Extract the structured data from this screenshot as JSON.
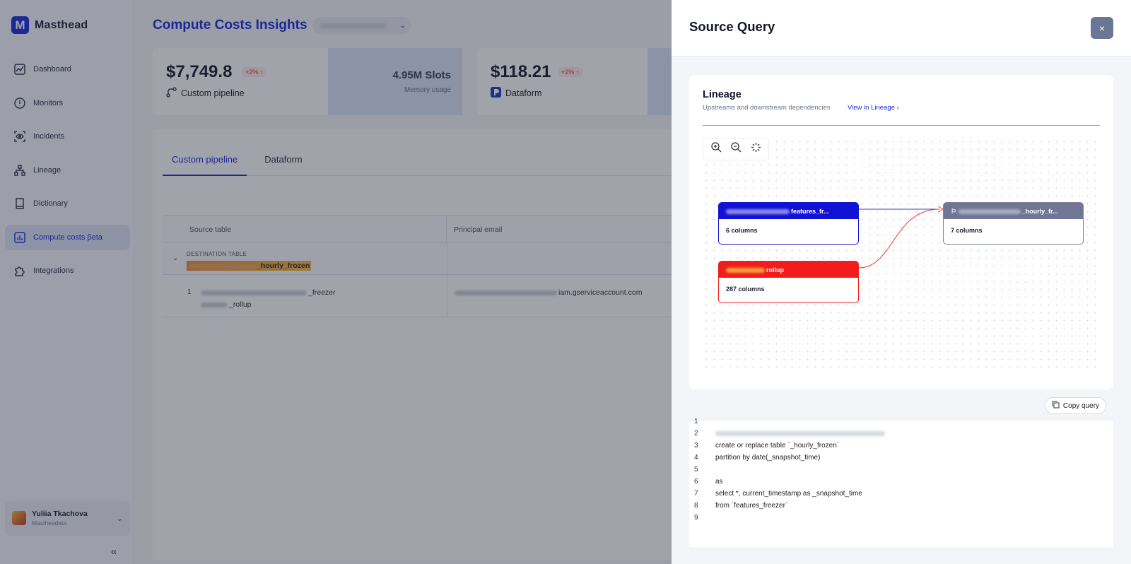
{
  "brand": {
    "logo_letter": "M",
    "name": "Masthead"
  },
  "sidebar": {
    "items": [
      {
        "label": "Dashboard",
        "icon": "chart-line-icon"
      },
      {
        "label": "Monitors",
        "icon": "alert-circle-icon"
      },
      {
        "label": "Incidents",
        "icon": "eye-icon"
      },
      {
        "label": "Lineage",
        "icon": "lineage-icon"
      },
      {
        "label": "Dictionary",
        "icon": "book-icon"
      },
      {
        "label": "Compute costs βeta",
        "icon": "bar-chart-icon",
        "active": true
      },
      {
        "label": "Integrations",
        "icon": "puzzle-icon"
      }
    ],
    "user": {
      "name": "Yuliia Tkachova",
      "org": "Mastheadata"
    },
    "collapse_label": "«"
  },
  "main": {
    "title": "Compute Costs Insights",
    "metrics": [
      {
        "value": "$7,749.8",
        "badge": "+2% ↑",
        "label": "Custom pipeline",
        "side_value": "4.95M Slots",
        "side_label": "Memory usage"
      },
      {
        "value": "$118.21",
        "badge": "+2% ↑",
        "label": "Dataform"
      }
    ],
    "tabs": [
      "Custom pipeline",
      "Dataform"
    ],
    "table": {
      "headers": [
        "Source table",
        "Principal email"
      ],
      "group_caption": "DESTINATION TABLE",
      "group_value": "_hourly_frozen",
      "rows": [
        {
          "num": "1",
          "line1": "_freezer",
          "line2": "_rollup",
          "email": "iam.gserviceaccount.com"
        }
      ]
    }
  },
  "drawer": {
    "title": "Source Query",
    "close_label": "×",
    "lineage": {
      "title": "Lineage",
      "subtitle": "Upstreams and downstream dependencies",
      "link": "View in Lineage",
      "nodes": [
        {
          "name": "features_fr...",
          "columns": "6 columns",
          "color": "#1212d6"
        },
        {
          "name": "rollup",
          "columns": "287 columns",
          "color": "#f21c1c"
        },
        {
          "name": "_hourly_fr...",
          "columns": "7 columns",
          "color": "#707694"
        }
      ]
    },
    "copy_label": "Copy query",
    "code": [
      {
        "n": "1",
        "text": ""
      },
      {
        "n": "2",
        "text": ""
      },
      {
        "n": "3",
        "text": "create or replace table `_hourly_frozen`"
      },
      {
        "n": "4",
        "text": "partition by date(_snapshot_time)"
      },
      {
        "n": "5",
        "text": ""
      },
      {
        "n": "6",
        "text": "as"
      },
      {
        "n": "7",
        "text": "select *, current_timestamp as _snapshot_time"
      },
      {
        "n": "8",
        "text": "from `features_freezer`"
      },
      {
        "n": "9",
        "text": ""
      }
    ]
  }
}
